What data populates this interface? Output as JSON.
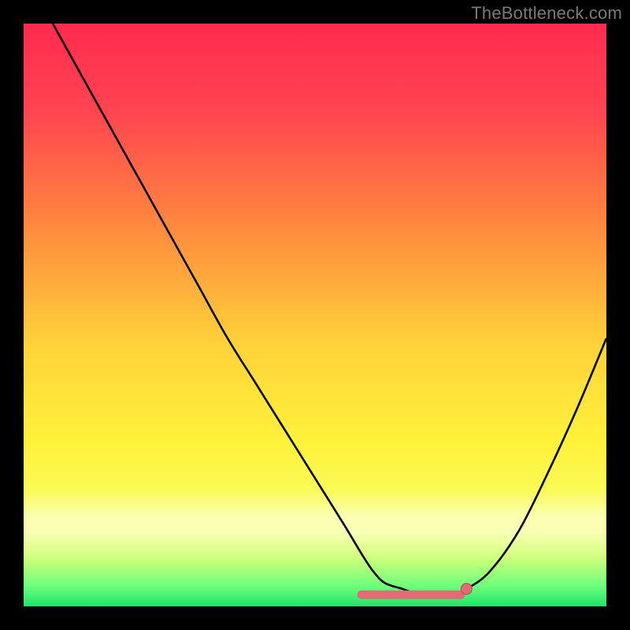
{
  "watermark": "TheBottleneck.com",
  "colors": {
    "frame": "#000000",
    "curve": "#000000",
    "marker_fill": "#e06c75",
    "marker_stroke": "#b84a50",
    "gradient_stops": [
      {
        "offset": 0.0,
        "color": "#ff2b4e"
      },
      {
        "offset": 0.15,
        "color": "#ff4450"
      },
      {
        "offset": 0.35,
        "color": "#ff8a3e"
      },
      {
        "offset": 0.55,
        "color": "#ffd23a"
      },
      {
        "offset": 0.72,
        "color": "#fff23a"
      },
      {
        "offset": 0.86,
        "color": "#f7ff6a"
      },
      {
        "offset": 0.92,
        "color": "#c8ff7a"
      },
      {
        "offset": 0.965,
        "color": "#6dff7a"
      },
      {
        "offset": 1.0,
        "color": "#20e36a"
      }
    ],
    "white_band": {
      "top_frac": 0.8,
      "height_frac": 0.12
    },
    "green_band": {
      "top_frac": 0.948,
      "height_frac": 0.052
    }
  },
  "chart_data": {
    "type": "line",
    "title": "",
    "xlabel": "",
    "ylabel": "",
    "xlim": [
      0,
      100
    ],
    "ylim": [
      0,
      100
    ],
    "note": "Axes are unlabeled; values are normalized 0–100 estimated from pixel positions within the plot area.",
    "series": [
      {
        "name": "curve",
        "x": [
          5,
          10,
          15,
          20,
          25,
          30,
          35,
          40,
          45,
          50,
          55,
          58,
          60,
          62,
          65,
          68,
          70,
          73,
          76,
          80,
          85,
          90,
          95,
          100
        ],
        "y": [
          100,
          91,
          82,
          73,
          64,
          55,
          46,
          38,
          30,
          22,
          14,
          9,
          6,
          4,
          3,
          2,
          2,
          2,
          3,
          6,
          13,
          23,
          34,
          46
        ]
      }
    ],
    "flat_segment": {
      "name": "trough-highlight",
      "x_start": 58,
      "x_end": 75,
      "y": 2
    },
    "marker": {
      "name": "selected-point",
      "x": 76,
      "y": 3
    }
  }
}
